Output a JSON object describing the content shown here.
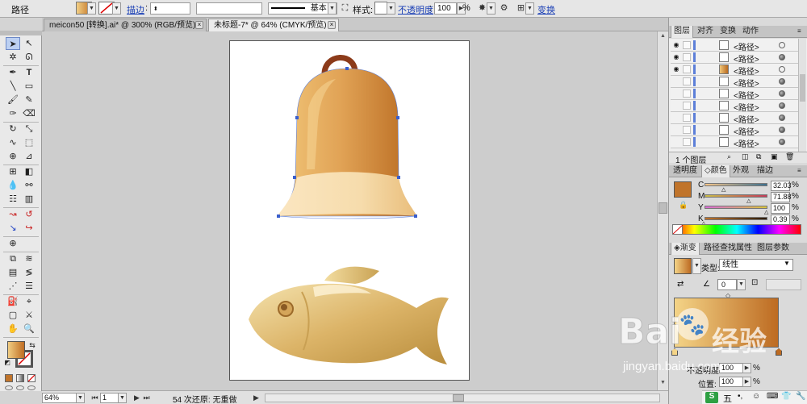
{
  "control_bar": {
    "object_type": "路径",
    "stroke_link": "描边",
    "stroke_profile": "基本",
    "style_label": "样式:",
    "opacity_link": "不透明度",
    "opacity_value": "100",
    "percent": "%",
    "transform_link": "变换"
  },
  "doc_tabs": [
    {
      "label": "meicon50 [转换].ai* @ 300% (RGB/预览)",
      "active": false
    },
    {
      "label": "未标题-7* @ 64% (CMYK/预览)",
      "active": true
    }
  ],
  "status_bar": {
    "zoom": "64%",
    "artboard_number": "1",
    "message": "54 次还原: 无重做"
  },
  "layers_panel": {
    "tabs": [
      "图层",
      "对齐",
      "变换",
      "动作"
    ],
    "rows": [
      {
        "name": "<路径>",
        "visible": true,
        "thumb": "white",
        "dot": "hollow"
      },
      {
        "name": "<路径>",
        "visible": true,
        "thumb": "white",
        "dot": "filled"
      },
      {
        "name": "<路径>",
        "visible": true,
        "thumb": "bell",
        "dot": "hollow"
      },
      {
        "name": "<路径>",
        "visible": false,
        "thumb": "white",
        "dot": "filled"
      },
      {
        "name": "<路径>",
        "visible": false,
        "thumb": "white",
        "dot": "filled"
      },
      {
        "name": "<路径>",
        "visible": false,
        "thumb": "white",
        "dot": "filled"
      },
      {
        "name": "<路径>",
        "visible": false,
        "thumb": "white",
        "dot": "filled"
      },
      {
        "name": "<路径>",
        "visible": false,
        "thumb": "white",
        "dot": "filled"
      },
      {
        "name": "<路径>",
        "visible": false,
        "thumb": "white",
        "dot": "filled"
      }
    ],
    "footer": "1 个图层"
  },
  "color_panel": {
    "tabs": [
      "透明度",
      "颜色",
      "外观",
      "描边"
    ],
    "swatch_color": "#c0742b",
    "channels": [
      {
        "label": "C",
        "value": "32.03",
        "level": 0.32
      },
      {
        "label": "M",
        "value": "71.88",
        "level": 0.72
      },
      {
        "label": "Y",
        "value": "100",
        "level": 1.0
      },
      {
        "label": "K",
        "value": "0.39",
        "level": 0.004
      }
    ]
  },
  "gradient_panel": {
    "tabs": [
      "渐变",
      "路径查找",
      "属性",
      "图层参数"
    ],
    "type_label": "类型:",
    "type_value": "线性",
    "angle": "0",
    "opacity_label": "不透明度:",
    "opacity_value": "100",
    "location_label": "位置:",
    "location_value": "100",
    "percent": "%",
    "start_color": "#f4d487",
    "end_color": "#bd6b22"
  },
  "watermark": {
    "brand": "Bai",
    "brand2": "经验",
    "url": "jingyan.baidu.com"
  },
  "taskbar": {
    "ime": "五"
  },
  "colors": {
    "accent_blue": "#3a5fcd",
    "bell_dark": "#b8691f",
    "bell_light": "#f0c47a",
    "fish_light": "#f3dfa5",
    "fish_dark": "#b88d3b"
  }
}
